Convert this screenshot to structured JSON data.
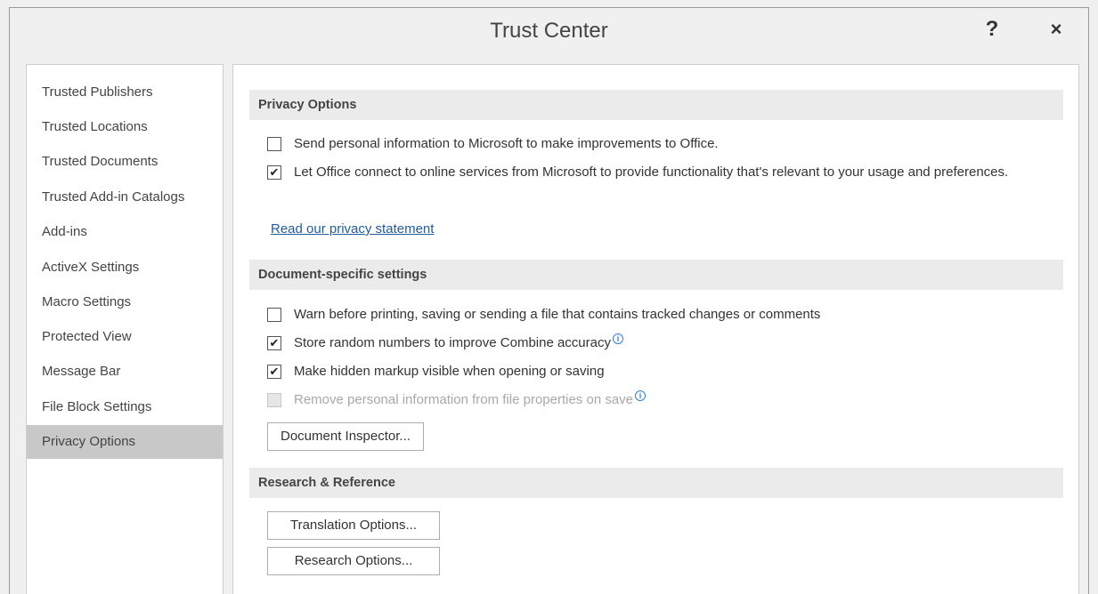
{
  "window": {
    "title": "Trust Center",
    "help_label": "?",
    "close_label": "×"
  },
  "sidebar": {
    "items": [
      {
        "label": "Trusted Publishers"
      },
      {
        "label": "Trusted Locations"
      },
      {
        "label": "Trusted Documents"
      },
      {
        "label": "Trusted Add-in Catalogs"
      },
      {
        "label": "Add-ins"
      },
      {
        "label": "ActiveX Settings"
      },
      {
        "label": "Macro Settings"
      },
      {
        "label": "Protected View"
      },
      {
        "label": "Message Bar"
      },
      {
        "label": "File Block Settings"
      },
      {
        "label": "Privacy Options",
        "selected": true
      }
    ]
  },
  "privacy": {
    "header": "Privacy Options",
    "options": [
      {
        "label": "Send personal information to Microsoft to make improvements to Office.",
        "checked": false
      },
      {
        "label": "Let Office connect to online services from Microsoft to provide functionality that's relevant to your usage and preferences.",
        "checked": true
      }
    ],
    "link": "Read our privacy statement"
  },
  "document": {
    "header": "Document-specific settings",
    "options": [
      {
        "label": "Warn before printing, saving or sending a file that contains tracked changes or comments",
        "checked": false
      },
      {
        "label": "Store random numbers to improve Combine accuracy",
        "checked": true,
        "info": true
      },
      {
        "label": "Make hidden markup visible when opening or saving",
        "checked": true
      },
      {
        "label": "Remove personal information from file properties on save",
        "checked": false,
        "disabled": true,
        "info": true
      }
    ],
    "inspector_button": "Document Inspector..."
  },
  "research": {
    "header": "Research & Reference",
    "translation_button": "Translation Options...",
    "research_button": "Research Options..."
  },
  "icons": {
    "check": "✔",
    "info": "i"
  }
}
